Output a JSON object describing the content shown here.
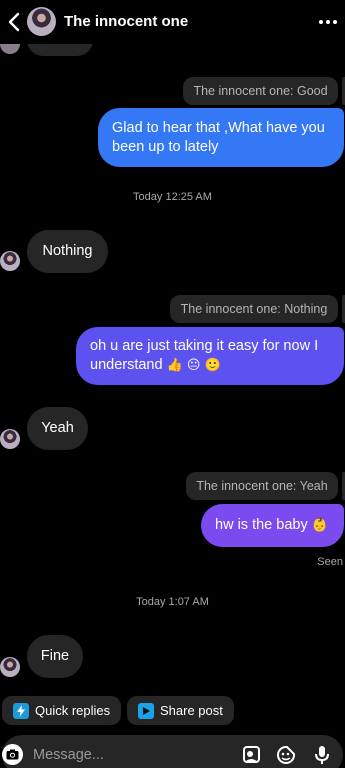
{
  "header": {
    "title": "The innocent one",
    "back_icon": "chevron-left-icon",
    "more_icon": "more-dots-icon"
  },
  "messages": [
    {
      "reply_to": "The innocent one: Good",
      "text": "Glad to hear that ,What have you been up to lately",
      "from": "me"
    },
    {
      "timestamp": "Today 12:25 AM"
    },
    {
      "text": "Nothing",
      "from": "them"
    },
    {
      "reply_to": "The innocent one: Nothing",
      "text": "oh u are just taking it easy for now   I understand",
      "emojis": "👍 😐 🙂",
      "from": "me"
    },
    {
      "text": "Yeah",
      "from": "them"
    },
    {
      "reply_to": "The innocent one: Yeah",
      "text": "hw is the baby",
      "emojis": "👶",
      "from": "me"
    },
    {
      "status": "Seen"
    },
    {
      "timestamp": "Today 1:07 AM"
    },
    {
      "text": "Fine",
      "from": "them"
    }
  ],
  "quick_actions": {
    "quick_replies": "Quick replies",
    "share_post": "Share post"
  },
  "composer": {
    "placeholder": "Message..."
  },
  "colors": {
    "bubble_blue": "#3478f6",
    "bubble_indigo": "#5b52f0",
    "bubble_purple": "#7b4bf0",
    "bubble_gray": "#262626",
    "background": "#000000"
  }
}
